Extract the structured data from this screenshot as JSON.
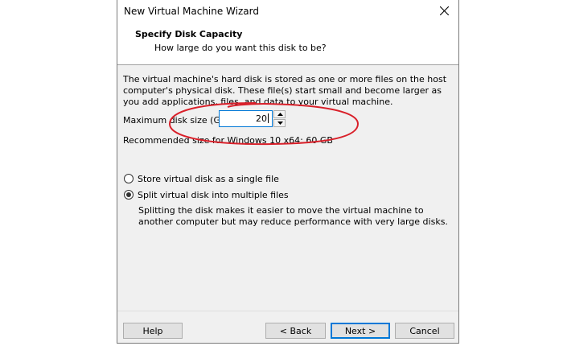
{
  "window": {
    "title": "New Virtual Machine Wizard"
  },
  "header": {
    "title": "Specify Disk Capacity",
    "subtitle": "How large do you want this disk to be?"
  },
  "content": {
    "description": "The virtual machine's hard disk is stored as one or more files on the host computer's physical disk. These file(s) start small and become larger as you add applications, files, and data to your virtual machine.",
    "max_size_label": "Maximum disk size (GB):",
    "max_size_value": "20",
    "recommended": "Recommended size for Windows 10 x64: 60 GB",
    "annotation_color": "#d9202a"
  },
  "disk_options": {
    "single_label": "Store virtual disk as a single file",
    "single_selected": false,
    "split_label": "Split virtual disk into multiple files",
    "split_selected": true,
    "split_description": "Splitting the disk makes it easier to move the virtual machine to another computer but may reduce performance with very large disks."
  },
  "buttons": {
    "help": "Help",
    "back": "< Back",
    "next": "Next >",
    "cancel": "Cancel"
  },
  "icons": {
    "close": "close-icon",
    "spin_up": "arrow-up-icon",
    "spin_down": "arrow-down-icon"
  }
}
